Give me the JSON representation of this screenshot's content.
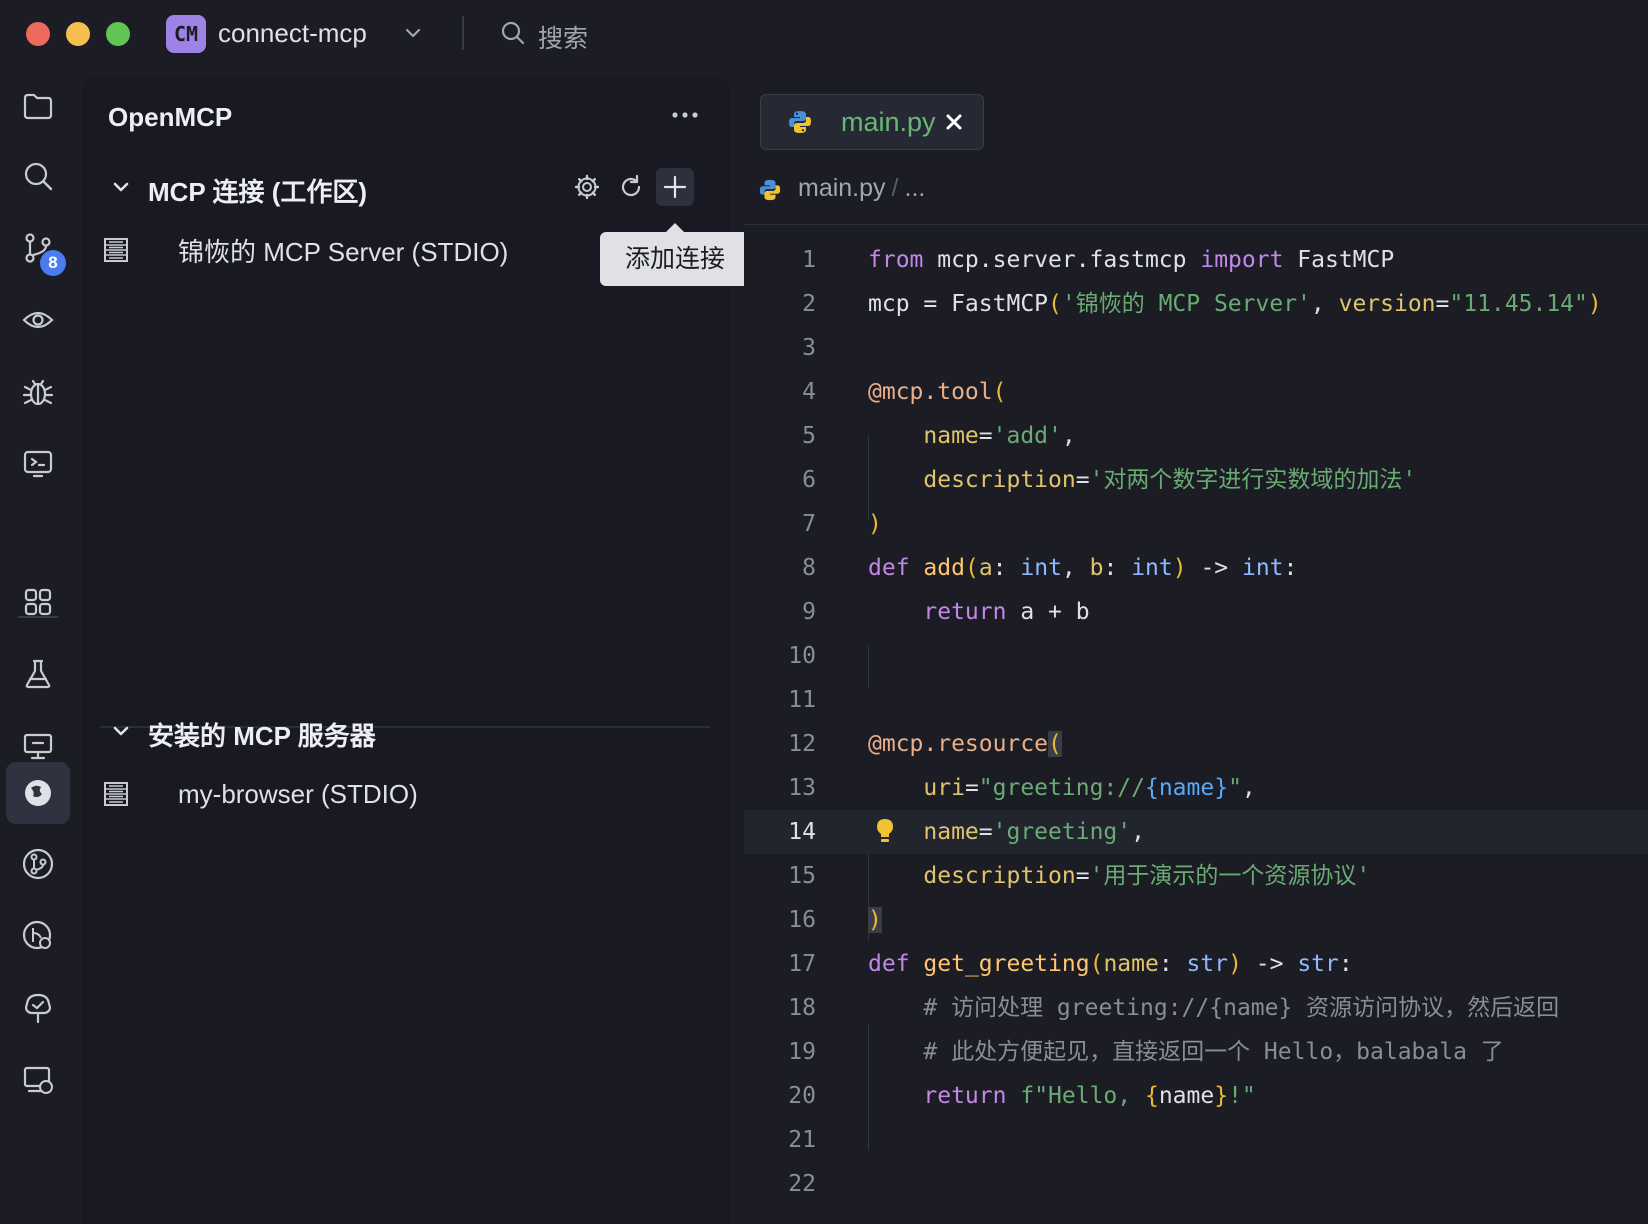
{
  "titlebar": {
    "project_badge": "CM",
    "project_name": "connect-mcp",
    "search_placeholder": "搜索"
  },
  "activity_bar": {
    "git_badge": "8",
    "items": [
      "folder-icon",
      "search-icon",
      "git-icon",
      "eye-icon",
      "bug-icon",
      "terminal-icon",
      "grid-icon",
      "flask-icon",
      "monitor-icon",
      "openmcp-icon",
      "branch-icon",
      "git-history-icon",
      "tree-icon",
      "remote-icon"
    ],
    "active_item": "openmcp-icon"
  },
  "panel": {
    "title": "OpenMCP",
    "sections": [
      {
        "title": "MCP 连接 (工作区)",
        "items": [
          {
            "label": "锦恢的 MCP Server (STDIO)"
          }
        ]
      },
      {
        "title": "安装的 MCP 服务器",
        "items": [
          {
            "label": "my-browser (STDIO)"
          }
        ]
      }
    ],
    "tooltip": "添加连接"
  },
  "editor": {
    "tab_label": "main.py",
    "breadcrumb": [
      "main.py",
      "..."
    ],
    "current_line": 14,
    "line_numbers": [
      "1",
      "2",
      "3",
      "4",
      "5",
      "6",
      "7",
      "8",
      "9",
      "10",
      "11",
      "12",
      "13",
      "14",
      "15",
      "16",
      "17",
      "18",
      "19",
      "20",
      "21",
      "22"
    ],
    "lines": [
      "from mcp.server.fastmcp import FastMCP",
      "mcp = FastMCP('锦恢的 MCP Server', version=\"11.45.14\")",
      "",
      "@mcp.tool(",
      "    name='add',",
      "    description='对两个数字进行实数域的加法'",
      ")",
      "def add(a: int, b: int) -> int:",
      "    return a + b",
      "",
      "",
      "@mcp.resource(",
      "    uri=\"greeting://{name}\",",
      "    name='greeting',",
      "    description='用于演示的一个资源协议'",
      ")",
      "def get_greeting(name: str) -> str:",
      "    # 访问处理 greeting://{name} 资源访问协议，然后返回",
      "    # 此处方便起见，直接返回一个 Hello，balabala 了",
      "    return f\"Hello, {name}!\"",
      "",
      ""
    ]
  },
  "colors": {
    "background": "#1b1c24",
    "panel": "#181922",
    "tab_text": "#67b874",
    "keyword": "#c387e6",
    "string": "#6aab73",
    "decorator": "#e8b08a",
    "badge": "#4a7bf0"
  }
}
